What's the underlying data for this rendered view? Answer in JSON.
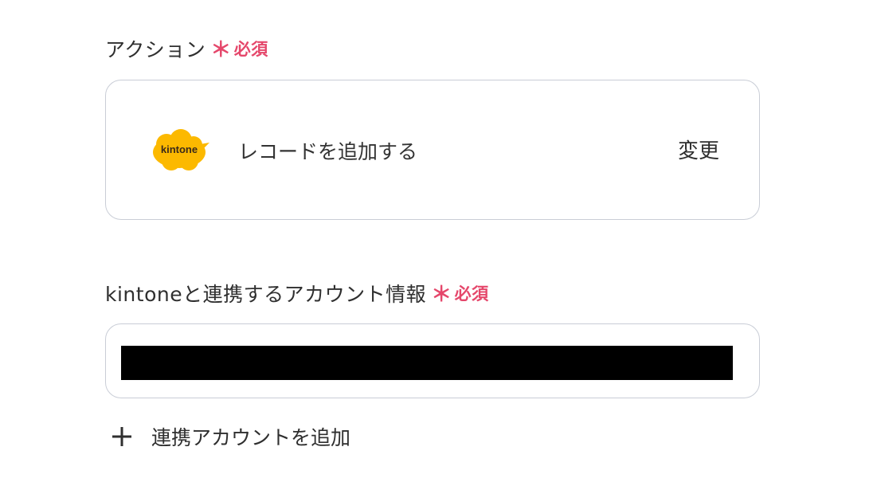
{
  "action_section": {
    "label": "アクション",
    "required_star": "＊",
    "required_text": "必須",
    "app_logo_text": "kintone",
    "action_name": "レコードを追加する",
    "change_label": "変更"
  },
  "account_section": {
    "label": "kintoneと連携するアカウント情報",
    "required_star": "＊",
    "required_text": "必須",
    "add_account_label": "連携アカウントを追加"
  },
  "colors": {
    "required": "#e5476b",
    "kintone_yellow": "#fcb900",
    "border": "#c9cdd6"
  },
  "icons": {
    "logo": "kintone-cloud-logo",
    "add": "plus-icon"
  }
}
